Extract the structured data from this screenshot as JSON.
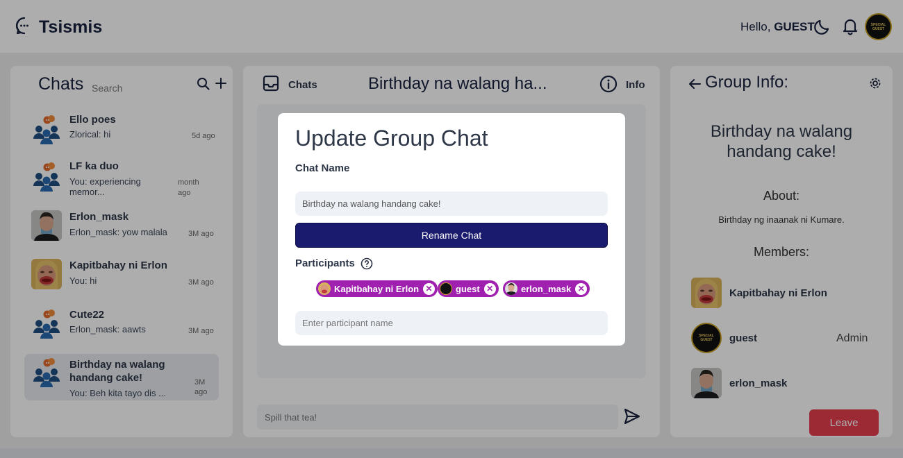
{
  "app": {
    "name": "Tsismis"
  },
  "header": {
    "greeting": "Hello,",
    "username": "GUEST",
    "avatar_text": "SPECIAL GUEST"
  },
  "sidebar": {
    "title": "Chats",
    "search_placeholder": "Search",
    "chats": [
      {
        "name": "Ello poes",
        "last": "Zlorical: hi",
        "time": "5d ago",
        "avatar": "group-icon"
      },
      {
        "name": "LF ka duo",
        "last": "You: experiencing memor...",
        "time": "month ago",
        "avatar": "group-icon"
      },
      {
        "name": "Erlon_mask",
        "last": "Erlon_mask: yow malala",
        "time": "3M ago",
        "avatar": "user-photo"
      },
      {
        "name": "Kapitbahay ni Erlon",
        "last": "You: hi",
        "time": "3M ago",
        "avatar": "user-photo"
      },
      {
        "name": "Cute22",
        "last": "Erlon_mask: aawts",
        "time": "3M ago",
        "avatar": "group-icon"
      },
      {
        "name": "Birthday na walang handang cake!",
        "last": "You: Beh kita tayo dis ...",
        "time": "3M ago",
        "avatar": "group-icon",
        "active": true
      }
    ]
  },
  "chat_panel": {
    "chats_label": "Chats",
    "title": "Birthday na walang ha...",
    "info_label": "Info",
    "message_placeholder": "Spill that tea!"
  },
  "group_info": {
    "title": "Group Info:",
    "name": "Birthday na walang handang cake!",
    "about_label": "About:",
    "about_text": "Birthday ng inaanak ni Kumare.",
    "members_label": "Members:",
    "members": [
      {
        "name": "Kapitbahay ni Erlon",
        "role": ""
      },
      {
        "name": "guest",
        "role": "Admin"
      },
      {
        "name": "erlon_mask",
        "role": ""
      }
    ],
    "leave_label": "Leave"
  },
  "modal": {
    "title": "Update Group Chat",
    "chat_name_label": "Chat Name",
    "chat_name_value": "Birthday na walang handang cake!",
    "rename_label": "Rename Chat",
    "participants_label": "Participants",
    "participants": [
      {
        "name": "Kapitbahay ni Erlon"
      },
      {
        "name": "guest"
      },
      {
        "name": "erlon_mask"
      }
    ],
    "participant_placeholder": "Enter participant name"
  },
  "colors": {
    "primary": "#1a1a6e",
    "chip": "#a020b0",
    "leave": "#e53e4e",
    "icon": "#1a2340"
  }
}
